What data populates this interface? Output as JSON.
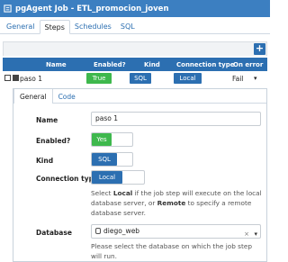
{
  "window": {
    "title": "pgAgent Job - ETL_promocion_joven"
  },
  "tabs": [
    {
      "label": "General"
    },
    {
      "label": "Steps"
    },
    {
      "label": "Schedules"
    },
    {
      "label": "SQL"
    }
  ],
  "grid": {
    "add_label": "+",
    "columns": [
      "Name",
      "Enabled?",
      "Kind",
      "Connection type",
      "On error"
    ],
    "row": {
      "name": "paso 1",
      "enabled": "True",
      "kind": "SQL",
      "connection": "Local",
      "on_error": "Fail"
    }
  },
  "step_tabs": [
    {
      "label": "General"
    },
    {
      "label": "Code"
    }
  ],
  "form": {
    "name_label": "Name",
    "name_value": "paso 1",
    "enabled_label": "Enabled?",
    "enabled_value": "Yes",
    "kind_label": "Kind",
    "kind_value": "SQL",
    "conn_label": "Connection type",
    "conn_value": "Local",
    "conn_help_1": "Select ",
    "conn_help_local": "Local",
    "conn_help_2": " if the job step will execute on the local database server, or ",
    "conn_help_remote": "Remote",
    "conn_help_3": " to specify a remote database server.",
    "db_label": "Database",
    "db_value": "diego_web",
    "db_clear": "×",
    "db_arrow": "▾",
    "db_help": "Please select the database on which the job step will run."
  },
  "colors": {
    "primary": "#2c6fb1",
    "success": "#3eb84d",
    "titlebar": "#3c7fc1"
  }
}
